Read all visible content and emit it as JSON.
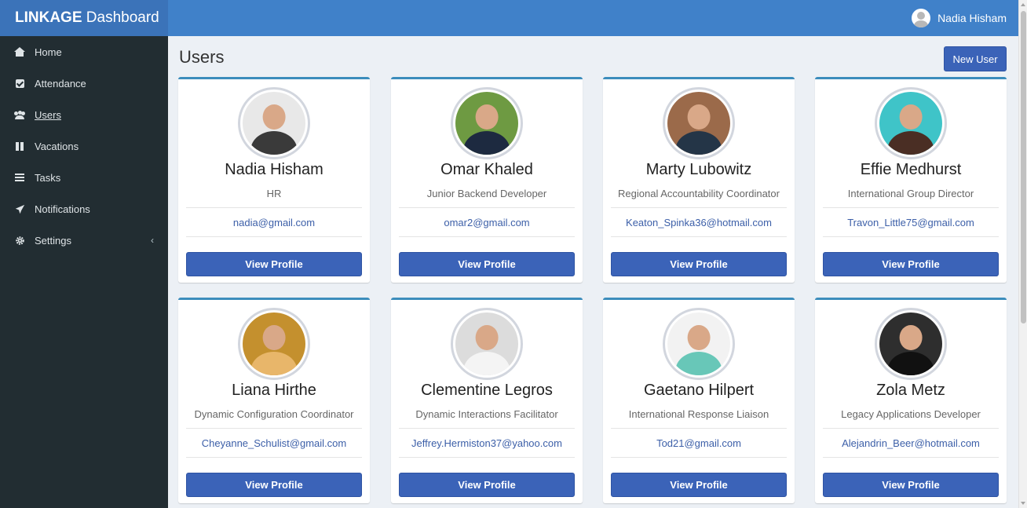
{
  "app": {
    "brand_bold": "LINKAGE",
    "brand_rest": " Dashboard",
    "current_user": "Nadia Hisham"
  },
  "sidebar": {
    "items": [
      {
        "label": "Home",
        "icon": "home-icon"
      },
      {
        "label": "Attendance",
        "icon": "check-square-icon"
      },
      {
        "label": "Users",
        "icon": "users-icon",
        "active": true
      },
      {
        "label": "Vacations",
        "icon": "pause-icon"
      },
      {
        "label": "Tasks",
        "icon": "tasks-icon"
      },
      {
        "label": "Notifications",
        "icon": "paper-plane-icon"
      },
      {
        "label": "Settings",
        "icon": "gear-icon",
        "expandable": true
      }
    ]
  },
  "page": {
    "title": "Users",
    "new_user_label": "New User"
  },
  "users": [
    {
      "name": "Nadia Hisham",
      "role": "HR",
      "email": "nadia@gmail.com",
      "button": "View Profile",
      "photo_bg": "#e8e8e8",
      "photo_fg": "#3a3a3a"
    },
    {
      "name": "Omar Khaled",
      "role": "Junior Backend Developer",
      "email": "omar2@gmail.com",
      "button": "View Profile",
      "photo_bg": "#6e9a42",
      "photo_fg": "#1d2a40"
    },
    {
      "name": "Marty Lubowitz",
      "role": "Regional Accountability Coordinator",
      "email": "Keaton_Spinka36@hotmail.com",
      "button": "View Profile",
      "photo_bg": "#9b6a4a",
      "photo_fg": "#243547"
    },
    {
      "name": "Effie Medhurst",
      "role": "International Group Director",
      "email": "Travon_Little75@gmail.com",
      "button": "View Profile",
      "photo_bg": "#3fc4c8",
      "photo_fg": "#4a2e24"
    },
    {
      "name": "Liana Hirthe",
      "role": "Dynamic Configuration Coordinator",
      "email": "Cheyanne_Schulist@gmail.com",
      "button": "View Profile",
      "photo_bg": "#c4902e",
      "photo_fg": "#e8b66a"
    },
    {
      "name": "Clementine Legros",
      "role": "Dynamic Interactions Facilitator",
      "email": "Jeffrey.Hermiston37@yahoo.com",
      "button": "View Profile",
      "photo_bg": "#dcdcdc",
      "photo_fg": "#f4f4f4"
    },
    {
      "name": "Gaetano Hilpert",
      "role": "International Response Liaison",
      "email": "Tod21@gmail.com",
      "button": "View Profile",
      "photo_bg": "#f2f2f2",
      "photo_fg": "#68c7b8"
    },
    {
      "name": "Zola Metz",
      "role": "Legacy Applications Developer",
      "email": "Alejandrin_Beer@hotmail.com",
      "button": "View Profile",
      "photo_bg": "#2e2e2e",
      "photo_fg": "#111111"
    }
  ]
}
